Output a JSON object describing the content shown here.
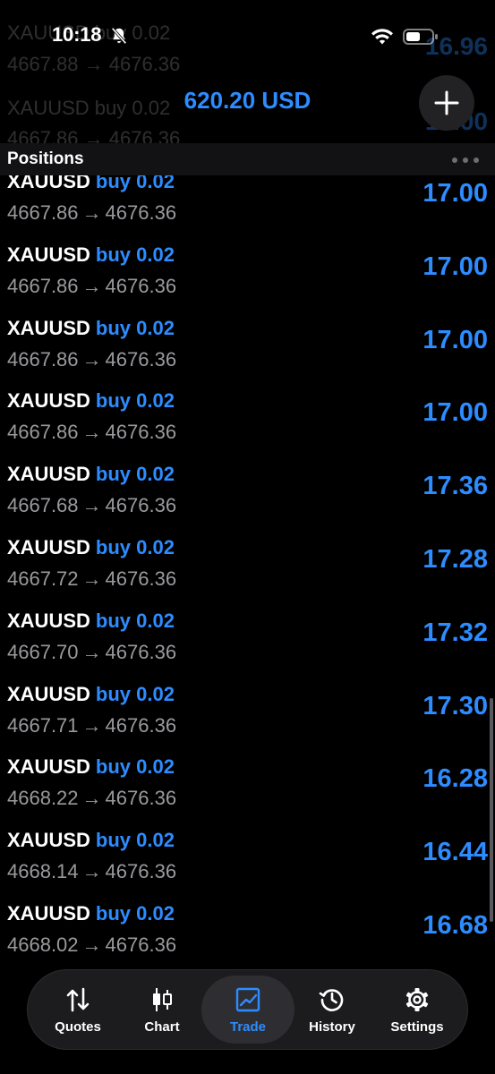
{
  "status_bar": {
    "time": "10:18"
  },
  "header": {
    "balance": "620.20 USD"
  },
  "section": {
    "title": "Positions"
  },
  "ghost_rows": [
    {
      "head": "XAUUSD buy 0.02",
      "prices": "4667.88 → 4676.36",
      "profit": "16.96"
    },
    {
      "head": "XAUUSD buy 0.02",
      "prices": "4667.86 → 4676.36",
      "profit": "17.00"
    }
  ],
  "positions": [
    {
      "symbol": "XAUUSD",
      "side": "buy 0.02",
      "open": "4667.86",
      "arrow": "→",
      "current": "4676.36",
      "profit": "17.00"
    },
    {
      "symbol": "XAUUSD",
      "side": "buy 0.02",
      "open": "4667.86",
      "arrow": "→",
      "current": "4676.36",
      "profit": "17.00"
    },
    {
      "symbol": "XAUUSD",
      "side": "buy 0.02",
      "open": "4667.86",
      "arrow": "→",
      "current": "4676.36",
      "profit": "17.00"
    },
    {
      "symbol": "XAUUSD",
      "side": "buy 0.02",
      "open": "4667.86",
      "arrow": "→",
      "current": "4676.36",
      "profit": "17.00"
    },
    {
      "symbol": "XAUUSD",
      "side": "buy 0.02",
      "open": "4667.68",
      "arrow": "→",
      "current": "4676.36",
      "profit": "17.36"
    },
    {
      "symbol": "XAUUSD",
      "side": "buy 0.02",
      "open": "4667.72",
      "arrow": "→",
      "current": "4676.36",
      "profit": "17.28"
    },
    {
      "symbol": "XAUUSD",
      "side": "buy 0.02",
      "open": "4667.70",
      "arrow": "→",
      "current": "4676.36",
      "profit": "17.32"
    },
    {
      "symbol": "XAUUSD",
      "side": "buy 0.02",
      "open": "4667.71",
      "arrow": "→",
      "current": "4676.36",
      "profit": "17.30"
    },
    {
      "symbol": "XAUUSD",
      "side": "buy 0.02",
      "open": "4668.22",
      "arrow": "→",
      "current": "4676.36",
      "profit": "16.28"
    },
    {
      "symbol": "XAUUSD",
      "side": "buy 0.02",
      "open": "4668.14",
      "arrow": "→",
      "current": "4676.36",
      "profit": "16.44"
    },
    {
      "symbol": "XAUUSD",
      "side": "buy 0.02",
      "open": "4668.02",
      "arrow": "→",
      "current": "4676.36",
      "profit": "16.68"
    }
  ],
  "tabs": [
    {
      "label": "Quotes",
      "icon": "quotes-arrows-icon",
      "active": false
    },
    {
      "label": "Chart",
      "icon": "candlestick-icon",
      "active": false
    },
    {
      "label": "Trade",
      "icon": "trade-chart-icon",
      "active": true
    },
    {
      "label": "History",
      "icon": "history-clock-icon",
      "active": false
    },
    {
      "label": "Settings",
      "icon": "gear-icon",
      "active": false
    }
  ],
  "colors": {
    "accent": "#2d8cff",
    "background": "#000000",
    "secondary_text": "#9a9a9e"
  }
}
